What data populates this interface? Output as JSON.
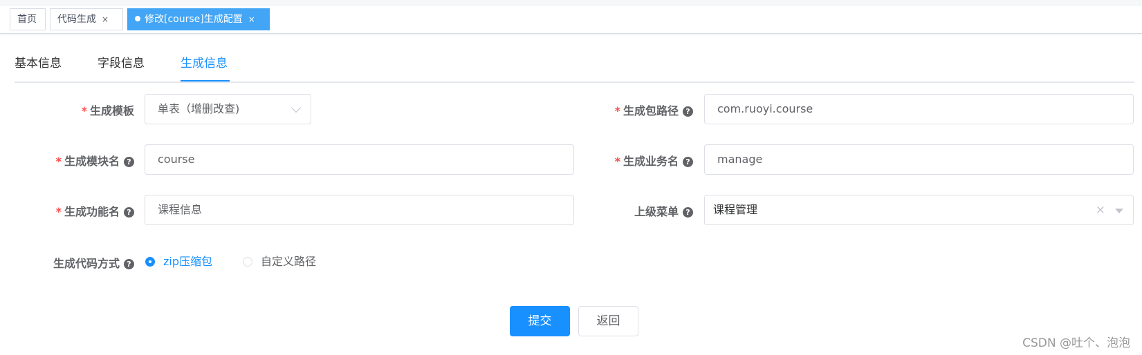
{
  "tags": [
    {
      "label": "首页",
      "closable": false,
      "active": false
    },
    {
      "label": "代码生成",
      "closable": true,
      "active": false
    },
    {
      "label": "修改[course]生成配置",
      "closable": true,
      "active": true
    }
  ],
  "tag_close_symbol": "×",
  "tabs": [
    "基本信息",
    "字段信息",
    "生成信息"
  ],
  "active_tab": "生成信息",
  "required_mark": "*",
  "help_icon": "?",
  "form": {
    "tpl_category": {
      "label": "生成模板",
      "value": "单表（增删改查)"
    },
    "package_name": {
      "label": "生成包路径",
      "value": "com.ruoyi.course"
    },
    "module_name": {
      "label": "生成模块名",
      "value": "course"
    },
    "business_name": {
      "label": "生成业务名",
      "value": "manage"
    },
    "function_name": {
      "label": "生成功能名",
      "value": "课程信息"
    },
    "parent_menu": {
      "label": "上级菜单",
      "value": "课程管理",
      "clear_symbol": "×"
    },
    "gen_type": {
      "label": "生成代码方式",
      "options": [
        "zip压缩包",
        "自定义路径"
      ],
      "selected": "zip压缩包"
    }
  },
  "buttons": {
    "submit": "提交",
    "back": "返回"
  },
  "watermark": "CSDN @吐个、泡泡",
  "colors": {
    "primary": "#1890ff",
    "active_tag": "#42a5f5",
    "required": "#ff4949"
  }
}
